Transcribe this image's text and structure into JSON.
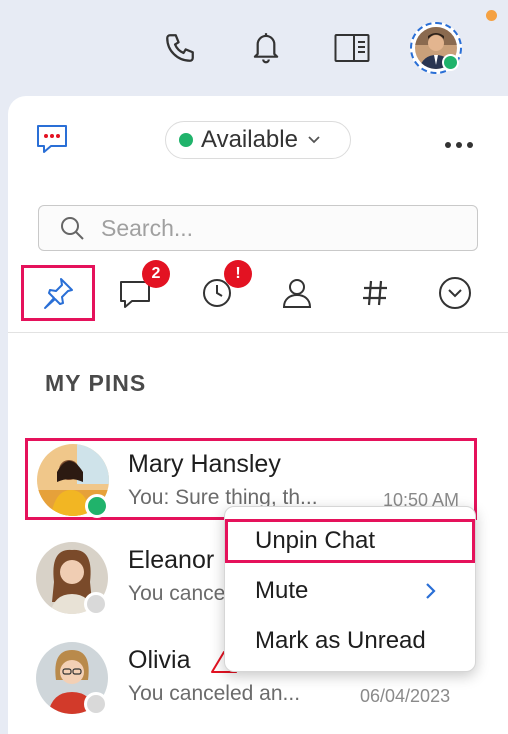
{
  "topbar": {
    "icons": [
      "phone-icon",
      "bell-icon",
      "panel-layout-icon",
      "profile-avatar"
    ],
    "accent_dot_color": "#f5a142"
  },
  "header": {
    "status_label": "Available",
    "status_color": "#20b36b",
    "icons": [
      "new-chat-icon",
      "more-options-icon"
    ]
  },
  "search": {
    "placeholder": "Search..."
  },
  "tabs": [
    {
      "icon": "pin-icon",
      "selected": true
    },
    {
      "icon": "chat-bubble-icon",
      "badge": "2"
    },
    {
      "icon": "clock-icon",
      "badge": "!"
    },
    {
      "icon": "person-icon"
    },
    {
      "icon": "hash-icon"
    },
    {
      "icon": "chevron-down-circle-icon"
    }
  ],
  "section_title": "MY PINS",
  "chats": [
    {
      "name": "Mary Hansley",
      "preview": "You: Sure thing, th...",
      "time": "10:50 AM",
      "presence": "online"
    },
    {
      "name": "Eleanor",
      "preview": "You canceled",
      "time": "",
      "presence": "offline"
    },
    {
      "name": "Olivia",
      "preview": "You canceled an...",
      "time": "06/04/2023",
      "presence": "offline"
    }
  ],
  "context_menu": {
    "items": [
      {
        "label": "Unpin Chat"
      },
      {
        "label": "Mute",
        "has_submenu": true
      },
      {
        "label": "Mark as Unread"
      }
    ]
  },
  "colors": {
    "highlight": "#e5125b",
    "badge": "#e31222",
    "link_blue": "#2a6fd6"
  }
}
